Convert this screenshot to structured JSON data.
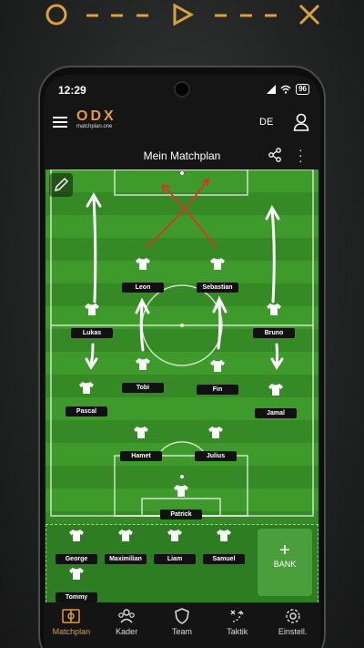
{
  "status": {
    "time": "12:29",
    "battery": "96"
  },
  "app": {
    "logo": "ODX",
    "logo_sub": "matchplan.one",
    "lang": "DE"
  },
  "header": {
    "title": "Mein Matchplan"
  },
  "field_players": [
    {
      "name": "Leon"
    },
    {
      "name": "Sebastian"
    },
    {
      "name": "Lukas"
    },
    {
      "name": "Bruno"
    },
    {
      "name": "Tobi"
    },
    {
      "name": "Fin"
    },
    {
      "name": "Pascal"
    },
    {
      "name": "Jamal"
    },
    {
      "name": "Hamet"
    },
    {
      "name": "Julius"
    },
    {
      "name": "Patrick"
    }
  ],
  "bench": {
    "players": [
      {
        "name": "George"
      },
      {
        "name": "Maximilian"
      },
      {
        "name": "Liam"
      },
      {
        "name": "Samuel"
      },
      {
        "name": "Tommy"
      }
    ],
    "button_label": "BANK"
  },
  "nav": [
    {
      "label": "Matchplan",
      "icon": "pitch-icon"
    },
    {
      "label": "Kader",
      "icon": "group-icon"
    },
    {
      "label": "Team",
      "icon": "shield-icon"
    },
    {
      "label": "Taktik",
      "icon": "tactic-icon"
    },
    {
      "label": "Einstell.",
      "icon": "gear-icon"
    }
  ],
  "colors": {
    "accent": "#e39a3b",
    "pitch": "#3f9a2c",
    "arrow_red": "#e0302a"
  }
}
